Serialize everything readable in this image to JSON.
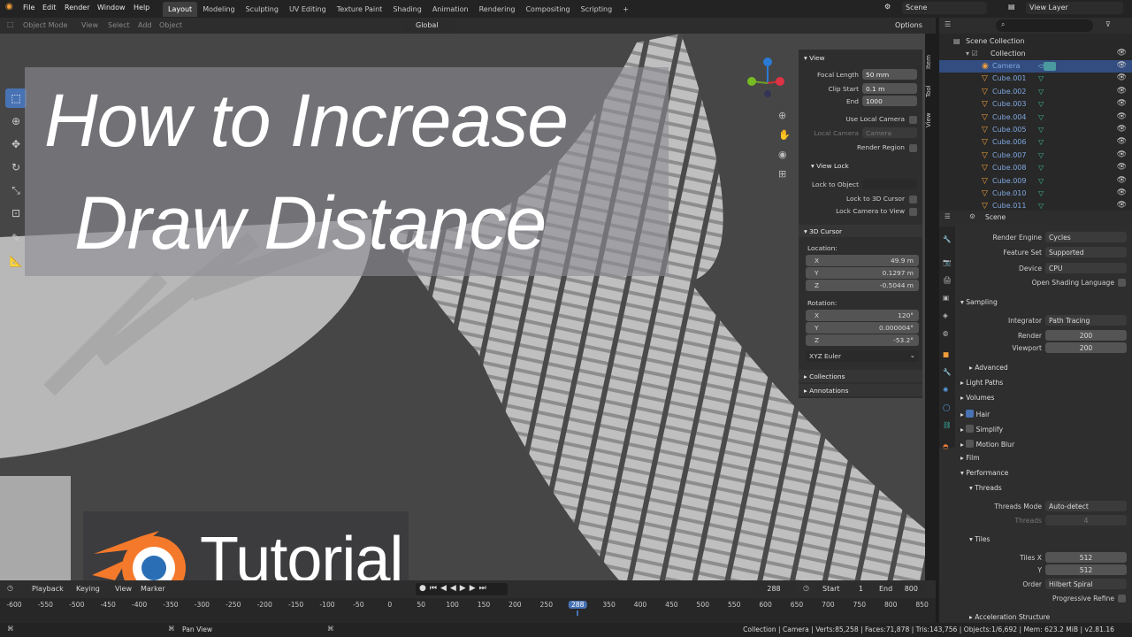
{
  "menu": [
    "File",
    "Edit",
    "Render",
    "Window",
    "Help"
  ],
  "workspaces": [
    "Layout",
    "Modeling",
    "Sculpting",
    "UV Editing",
    "Texture Paint",
    "Shading",
    "Animation",
    "Rendering",
    "Compositing",
    "Scripting"
  ],
  "active_workspace": "Layout",
  "scene": {
    "label": "Scene",
    "view_layer": "View Layer"
  },
  "header": {
    "transform_orientation": "Global",
    "options": "Options",
    "mode": "Object Mode",
    "view": "View",
    "select": "Select",
    "add": "Add",
    "object": "Object"
  },
  "overlay": {
    "title_line1": "How to Increase",
    "title_line2": "Draw Distance",
    "tutorial": "Tutorial"
  },
  "npanel": {
    "tabs": [
      "Item",
      "Tool",
      "View"
    ],
    "view_section": "View",
    "focal_length": {
      "label": "Focal Length",
      "value": "50 mm"
    },
    "clip_start": {
      "label": "Clip Start",
      "value": "0.1 m"
    },
    "clip_end": {
      "label": "End",
      "value": "1000"
    },
    "use_local_camera": "Use Local Camera",
    "local_camera": {
      "label": "Local Camera",
      "value": "Camera"
    },
    "render_region": "Render Region",
    "view_lock": "View Lock",
    "lock_to_object": "Lock to Object",
    "lock_to_3d_cursor": "Lock to 3D Cursor",
    "lock_camera_to_view": "Lock Camera to View",
    "cursor_section": "3D Cursor",
    "location": "Location:",
    "loc": [
      {
        "axis": "X",
        "value": "49.9 m"
      },
      {
        "axis": "Y",
        "value": "0.1297 m"
      },
      {
        "axis": "Z",
        "value": "-0.5044 m"
      }
    ],
    "rotation": "Rotation:",
    "rot": [
      {
        "axis": "X",
        "value": "120°"
      },
      {
        "axis": "Y",
        "value": "0.000004°"
      },
      {
        "axis": "Z",
        "value": "-53.2°"
      }
    ],
    "rotation_mode": "XYZ Euler",
    "collections": "Collections",
    "annotations": "Annotations"
  },
  "outliner": {
    "root": "Scene Collection",
    "collection": "Collection",
    "items": [
      "Camera",
      "Cube.001",
      "Cube.002",
      "Cube.003",
      "Cube.004",
      "Cube.005",
      "Cube.006",
      "Cube.007",
      "Cube.008",
      "Cube.009",
      "Cube.010",
      "Cube.011"
    ]
  },
  "properties": {
    "context": "Scene",
    "render_engine": {
      "label": "Render Engine",
      "value": "Cycles"
    },
    "feature_set": {
      "label": "Feature Set",
      "value": "Supported"
    },
    "device": {
      "label": "Device",
      "value": "CPU"
    },
    "osl": "Open Shading Language",
    "sampling": "Sampling",
    "integrator": {
      "label": "Integrator",
      "value": "Path Tracing"
    },
    "render_samples": {
      "label": "Render",
      "value": "200"
    },
    "viewport_samples": {
      "label": "Viewport",
      "value": "200"
    },
    "advanced": "Advanced",
    "light_paths": "Light Paths",
    "volumes": "Volumes",
    "hair": "Hair",
    "simplify": "Simplify",
    "motion_blur": "Motion Blur",
    "film": "Film",
    "performance": "Performance",
    "threads": "Threads",
    "threads_mode": {
      "label": "Threads Mode",
      "value": "Auto-detect"
    },
    "threads_count": {
      "label": "Threads",
      "value": "4"
    },
    "tiles": "Tiles",
    "tiles_x": {
      "label": "Tiles X",
      "value": "512"
    },
    "tiles_y": {
      "label": "Y",
      "value": "512"
    },
    "order": {
      "label": "Order",
      "value": "Hilbert Spiral"
    },
    "progressive_refine": "Progressive Refine",
    "acceleration_structure": "Acceleration Structure"
  },
  "timeline": {
    "playback": "Playback",
    "keying": "Keying",
    "view": "View",
    "marker": "Marker",
    "current_frame": "288",
    "start_label": "Start",
    "start": "1",
    "end_label": "End",
    "end": "800",
    "ruler": [
      "-600",
      "-550",
      "-500",
      "-450",
      "-400",
      "-350",
      "-300",
      "-250",
      "-200",
      "-150",
      "-100",
      "-50",
      "0",
      "50",
      "100",
      "150",
      "200",
      "250",
      "288",
      "350",
      "400",
      "450",
      "500",
      "550",
      "600",
      "650",
      "700",
      "750",
      "800",
      "850"
    ]
  },
  "status": {
    "pan": "Pan View",
    "stats": "Collection | Camera | Verts:85,258 | Faces:71,878 | Tris:143,756 | Objects:1/6,692 | Mem: 623.2 MiB | v2.81.16"
  },
  "colors": {
    "accent": "#4772b3",
    "orange": "#f09e3b",
    "panel": "#2e2e2e",
    "viewport": "#444444"
  }
}
